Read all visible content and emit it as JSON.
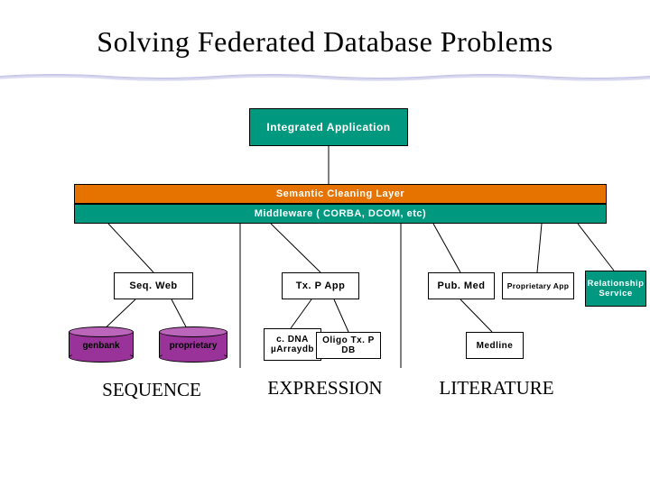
{
  "title": "Solving Federated Database Problems",
  "boxes": {
    "integrated": "Integrated Application",
    "semantic": "Semantic Cleaning Layer",
    "middleware": "Middleware ( CORBA, DCOM, etc)",
    "seqweb": "Seq. Web",
    "txpapp": "Tx. P App",
    "pubmed": "Pub. Med",
    "propapp": "Proprietary App",
    "relserv": "Relationship Service",
    "cdna": "c. DNA µArraydb",
    "oligo": "Oligo Tx. P DB",
    "medline": "Medline"
  },
  "cylinders": {
    "genbank": "genbank",
    "proprietary": "proprietary"
  },
  "sections": {
    "sequence": "SEQUENCE",
    "expression": "EXPRESSION",
    "literature": "LITERATURE"
  },
  "colors": {
    "teal": "#009980",
    "orange": "#e67300",
    "purple": "#993399"
  }
}
